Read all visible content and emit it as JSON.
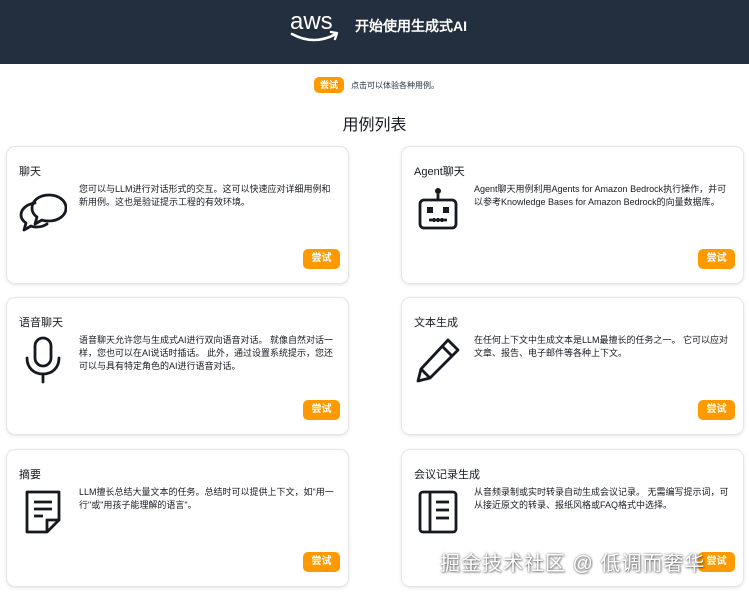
{
  "header": {
    "title": "开始使用生成式AI",
    "logo_icon": "aws-logo-icon"
  },
  "top": {
    "try_label": "尝试",
    "hint": "点击可以体验各种用例。"
  },
  "list_title": "用例列表",
  "cards": [
    {
      "title": "聊天",
      "icon": "chat-bubbles-icon",
      "description": "您可以与LLM进行对话形式的交互。这可以快速应对详细用例和新用例。这也是验证提示工程的有效环境。",
      "button": "尝试"
    },
    {
      "title": "Agent聊天",
      "icon": "robot-icon",
      "description": "Agent聊天用例利用Agents for Amazon Bedrock执行操作，并可以参考Knowledge Bases for Amazon Bedrock的向量数据库。",
      "button": "尝试"
    },
    {
      "title": "语音聊天",
      "icon": "microphone-icon",
      "description": "语音聊天允许您与生成式AI进行双向语音对话。 就像自然对话一样，您也可以在AI说话时插话。 此外，通过设置系统提示，您还可以与具有特定角色的AI进行语音对话。",
      "button": "尝试"
    },
    {
      "title": "文本生成",
      "icon": "pencil-icon",
      "description": "在任何上下文中生成文本是LLM最擅长的任务之一。 它可以应对文章、报告、电子邮件等各种上下文。",
      "button": "尝试"
    },
    {
      "title": "摘要",
      "icon": "document-icon",
      "description": "LLM擅长总结大量文本的任务。总结时可以提供上下文，如\"用一行\"或\"用孩子能理解的语言\"。",
      "button": "尝试"
    },
    {
      "title": "会议记录生成",
      "icon": "notes-icon",
      "description": "从音频录制或实时转录自动生成会议记录。 无需编写提示词，可从接近原文的转录、报纸风格或FAQ格式中选择。",
      "button": "尝试"
    }
  ],
  "watermark": "掘金技术社区 @ 低调而奢华",
  "colors": {
    "header_bg": "#232f3e",
    "accent": "#ff9900",
    "text": "#16191f"
  }
}
